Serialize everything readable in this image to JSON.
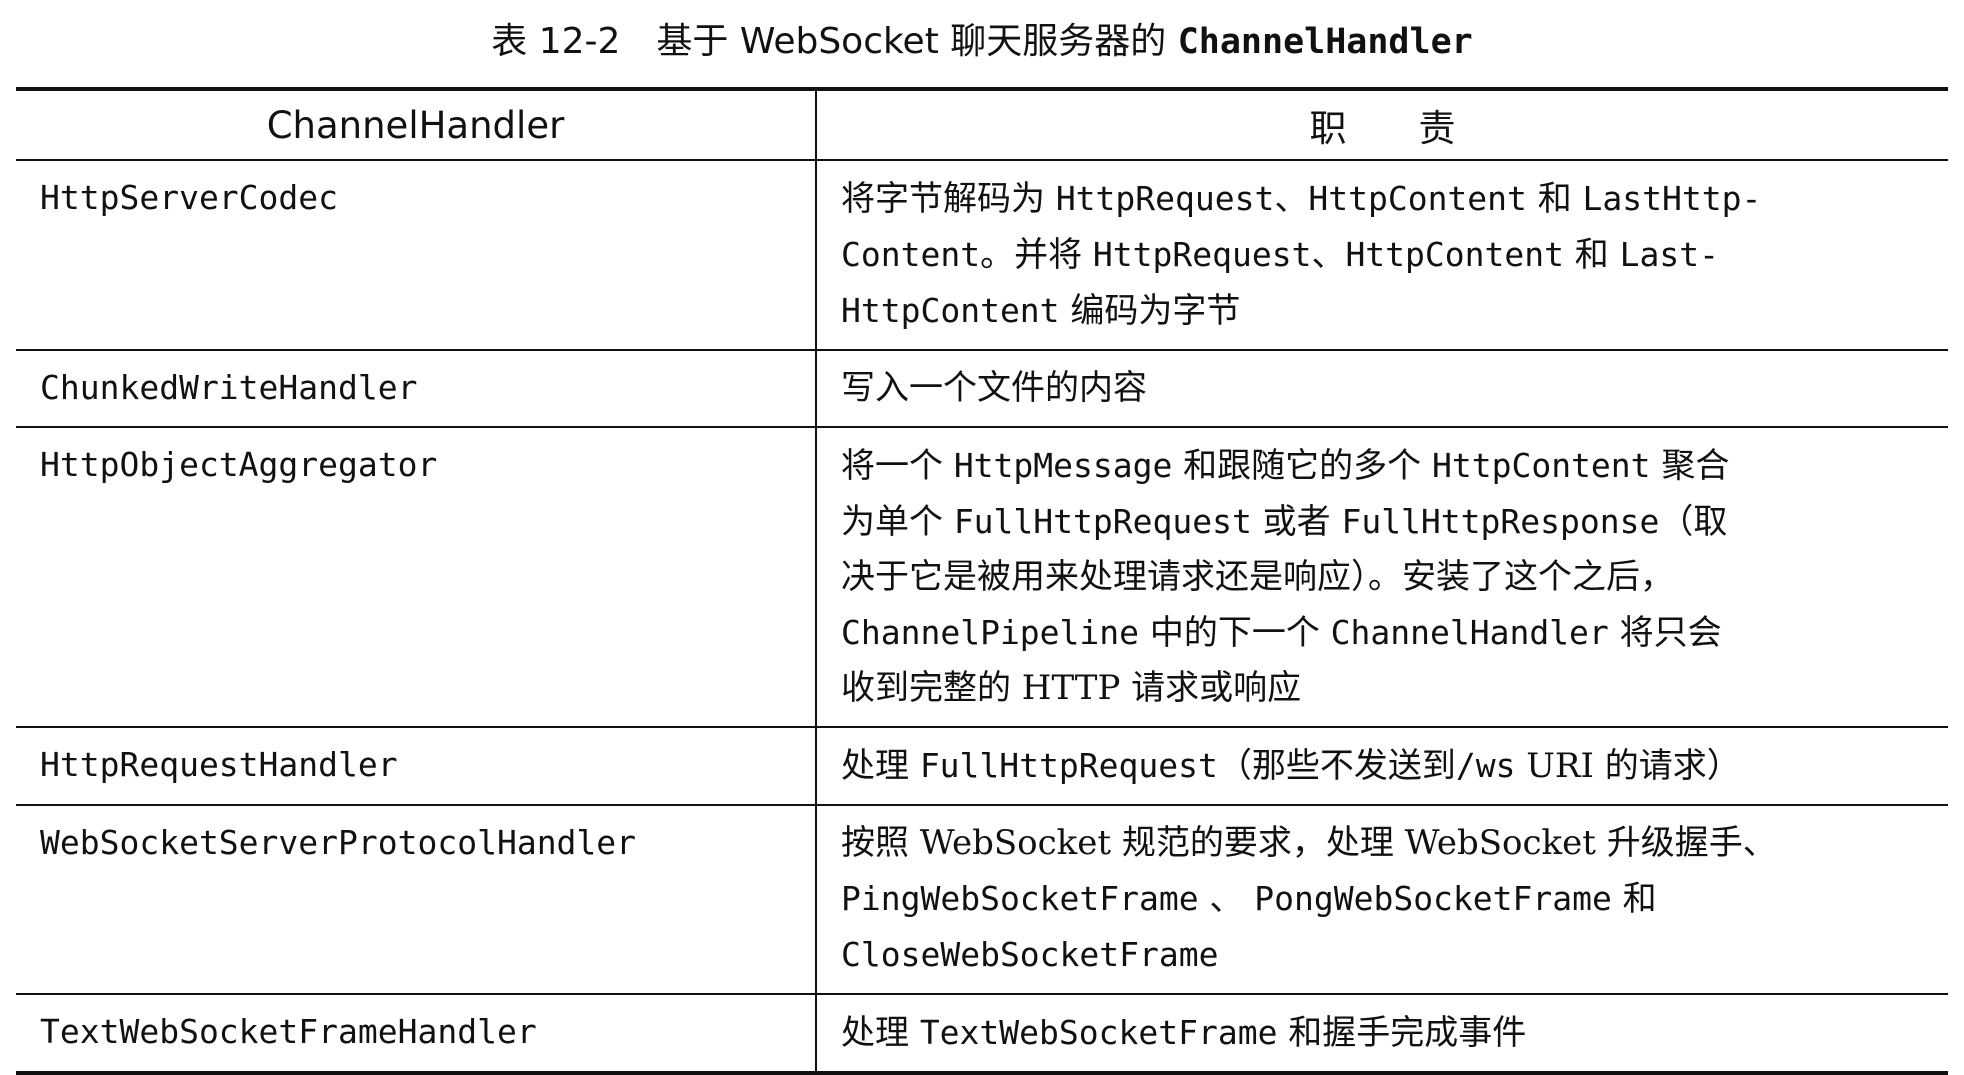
{
  "caption": {
    "prefix": "表 12-2　基于 WebSocket 聊天服务器的 ",
    "code": "ChannelHandler"
  },
  "table": {
    "headers": [
      "ChannelHandler",
      "职",
      "责"
    ],
    "rows": [
      {
        "name": "HttpServerCodec",
        "desc": [
          {
            "t": "将字节解码为 "
          },
          {
            "t": "HttpRequest",
            "m": 1
          },
          {
            "t": "、"
          },
          {
            "t": "HttpContent",
            "m": 1
          },
          {
            "t": " 和 "
          },
          {
            "t": "LastHttp-",
            "m": 1
          },
          {
            "br": 1
          },
          {
            "t": "Content",
            "m": 1
          },
          {
            "t": "。并将 "
          },
          {
            "t": "HttpRequest",
            "m": 1
          },
          {
            "t": "、"
          },
          {
            "t": "HttpContent",
            "m": 1
          },
          {
            "t": " 和 "
          },
          {
            "t": "Last-",
            "m": 1
          },
          {
            "br": 1
          },
          {
            "t": "HttpContent",
            "m": 1
          },
          {
            "t": " 编码为字节"
          }
        ]
      },
      {
        "name": "ChunkedWriteHandler",
        "desc": [
          {
            "t": "写入一个文件的内容"
          }
        ]
      },
      {
        "name": "HttpObjectAggregator",
        "desc": [
          {
            "t": "将一个 "
          },
          {
            "t": "HttpMessage",
            "m": 1
          },
          {
            "t": " 和跟随它的多个 "
          },
          {
            "t": "HttpContent",
            "m": 1
          },
          {
            "t": " 聚合"
          },
          {
            "br": 1
          },
          {
            "t": "为单个 "
          },
          {
            "t": "FullHttpRequest",
            "m": 1
          },
          {
            "t": " 或者 "
          },
          {
            "t": "FullHttpResponse",
            "m": 1
          },
          {
            "t": "（取"
          },
          {
            "br": 1
          },
          {
            "t": "决于它是被用来处理请求还是响应）。安装了这个之后，"
          },
          {
            "br": 1
          },
          {
            "t": "ChannelPipeline",
            "m": 1
          },
          {
            "t": " 中的下一个 "
          },
          {
            "t": "ChannelHandler",
            "m": 1
          },
          {
            "t": " 将只会"
          },
          {
            "br": 1
          },
          {
            "t": "收到完整的 HTTP 请求或响应"
          }
        ]
      },
      {
        "name": "HttpRequestHandler",
        "desc": [
          {
            "t": "处理 "
          },
          {
            "t": "FullHttpRequest",
            "m": 1
          },
          {
            "t": "（那些不发送到"
          },
          {
            "t": "/ws",
            "m": 1
          },
          {
            "t": " URI 的请求）"
          }
        ]
      },
      {
        "name": "WebSocketServerProtocolHandler",
        "desc": [
          {
            "t": "按照 WebSocket 规范的要求，处理 WebSocket 升级握手、"
          },
          {
            "br": 1
          },
          {
            "t": "PingWebSocketFrame",
            "m": 1
          },
          {
            "t": " 、 "
          },
          {
            "t": "PongWebSocketFrame",
            "m": 1
          },
          {
            "t": " 和"
          },
          {
            "br": 1
          },
          {
            "t": "CloseWebSocketFrame",
            "m": 1
          }
        ]
      },
      {
        "name": "TextWebSocketFrameHandler",
        "desc": [
          {
            "t": "处理 "
          },
          {
            "t": "TextWebSocketFrame",
            "m": 1
          },
          {
            "t": " 和握手完成事件"
          }
        ]
      }
    ]
  }
}
